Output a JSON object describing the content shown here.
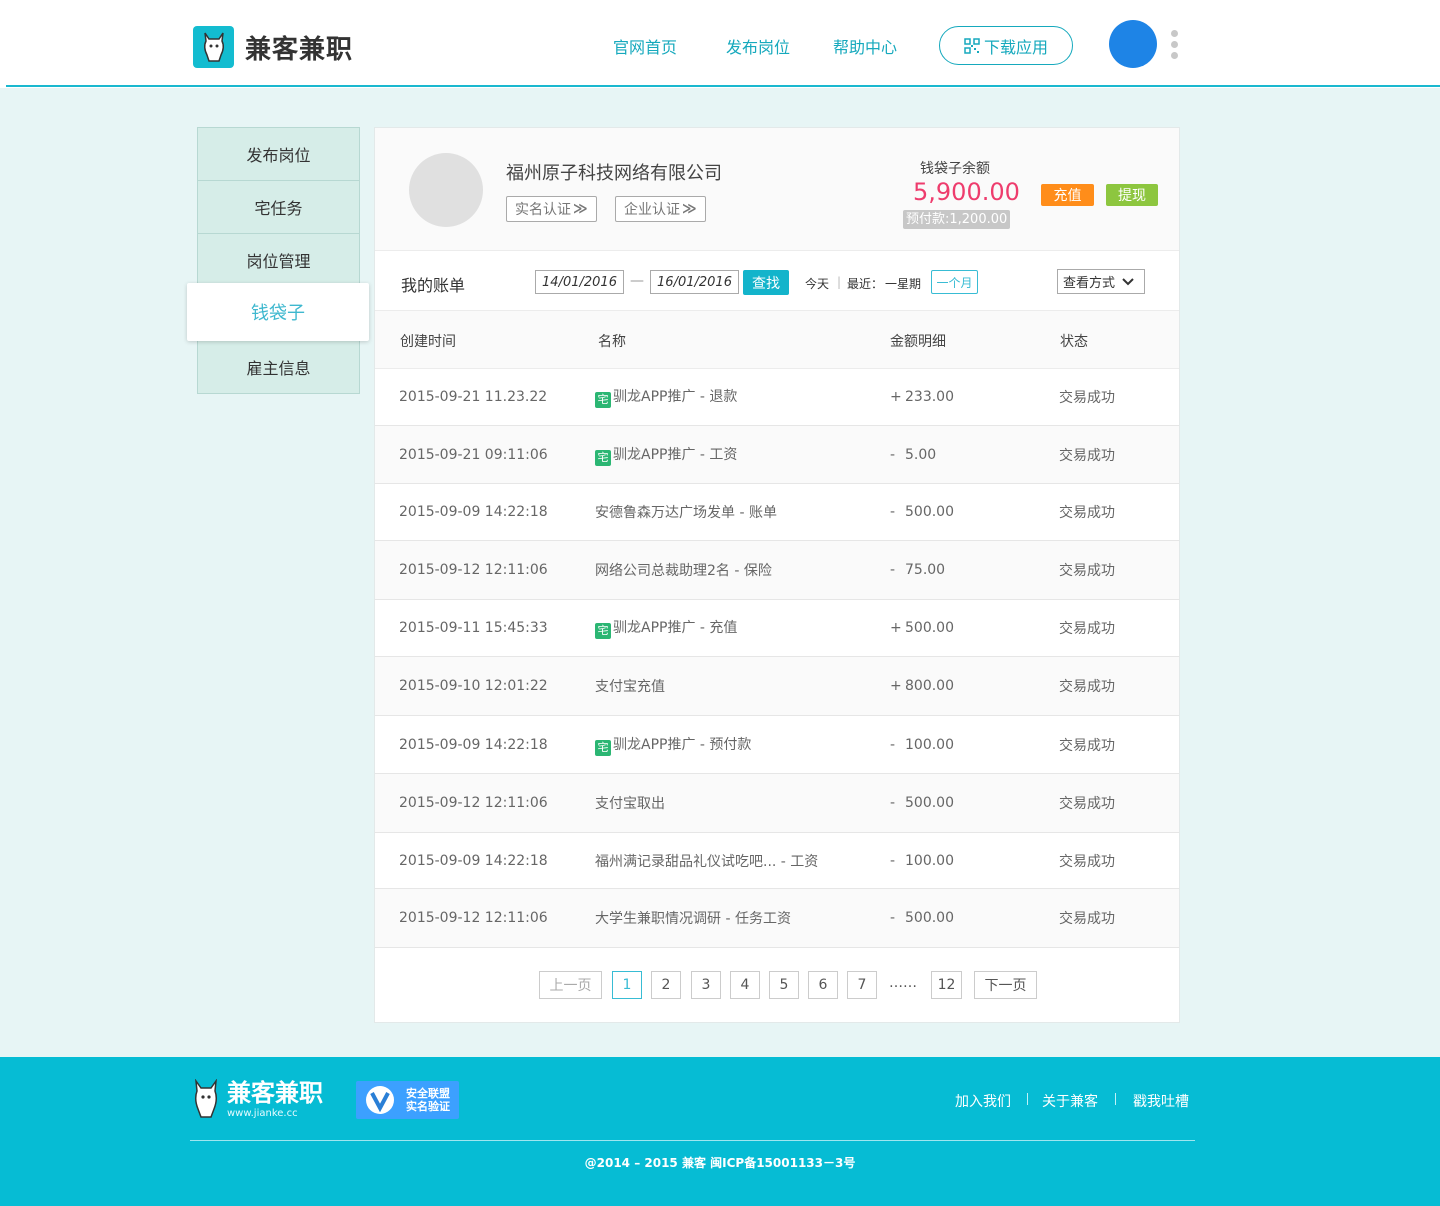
{
  "header": {
    "logo_text": "兼客兼职",
    "nav": [
      "官网首页",
      "发布岗位",
      "帮助中心"
    ],
    "download_label": "下载应用"
  },
  "sidebar": {
    "items": [
      "发布岗位",
      "宅任务",
      "岗位管理",
      "钱袋子",
      "雇主信息"
    ],
    "active": "钱袋子"
  },
  "profile": {
    "company_name": "福州原子科技网络有限公司",
    "cert_realname": "实名认证",
    "cert_company": "企业认证",
    "balance_label": "钱袋子余额",
    "balance_value": "5,900.00",
    "prepay": "预付款:1,200.00",
    "recharge_label": "充值",
    "withdraw_label": "提现"
  },
  "bill": {
    "title": "我的账单",
    "date_from": "14/01/2016",
    "date_sep": "—",
    "date_to": "16/01/2016",
    "search_label": "查找",
    "today": "今天",
    "recent": "最近：",
    "week": "一星期",
    "month": "一个月",
    "view_mode": "查看方式"
  },
  "table": {
    "headers": [
      "创建时间",
      "名称",
      "金额明细",
      "状态"
    ],
    "tag_label": "宅",
    "rows": [
      {
        "time": "2015-09-21 11.23.22",
        "tagged": true,
        "name": "驯龙APP推广 - 退款",
        "sign": "+",
        "amount": "233.00",
        "status": "交易成功"
      },
      {
        "time": "2015-09-21 09:11:06",
        "tagged": true,
        "name": "驯龙APP推广 - 工资",
        "sign": "-",
        "amount": "5.00",
        "status": "交易成功"
      },
      {
        "time": "2015-09-09 14:22:18",
        "tagged": false,
        "name": "安德鲁森万达广场发单 - 账单",
        "sign": "-",
        "amount": "500.00",
        "status": "交易成功"
      },
      {
        "time": "2015-09-12 12:11:06",
        "tagged": false,
        "name": "网络公司总裁助理2名 - 保险",
        "sign": "-",
        "amount": "75.00",
        "status": "交易成功"
      },
      {
        "time": "2015-09-11 15:45:33",
        "tagged": true,
        "name": "驯龙APP推广 - 充值",
        "sign": "+",
        "amount": "500.00",
        "status": "交易成功"
      },
      {
        "time": "2015-09-10 12:01:22",
        "tagged": false,
        "name": "支付宝充值",
        "sign": "+",
        "amount": "800.00",
        "status": "交易成功"
      },
      {
        "time": "2015-09-09 14:22:18",
        "tagged": true,
        "name": "驯龙APP推广 - 预付款",
        "sign": "-",
        "amount": "100.00",
        "status": "交易成功"
      },
      {
        "time": "2015-09-12 12:11:06",
        "tagged": false,
        "name": "支付宝取出",
        "sign": "-",
        "amount": "500.00",
        "status": "交易成功"
      },
      {
        "time": "2015-09-09 14:22:18",
        "tagged": false,
        "name": "福州满记录甜品礼仪试吃吧... - 工资",
        "sign": "-",
        "amount": "100.00",
        "status": "交易成功"
      },
      {
        "time": "2015-09-12 12:11:06",
        "tagged": false,
        "name": "大学生兼职情况调研 - 任务工资",
        "sign": "-",
        "amount": "500.00",
        "status": "交易成功"
      }
    ]
  },
  "pagination": {
    "prev": "上一页",
    "pages": [
      "1",
      "2",
      "3",
      "4",
      "5",
      "6",
      "7"
    ],
    "current": "1",
    "ellipsis": "……",
    "last": "12",
    "next": "下一页"
  },
  "footer": {
    "logo_text": "兼客兼职",
    "logo_url": "www.jianke.cc",
    "badge_line1": "安全联盟",
    "badge_line2": "实名验证",
    "links": [
      "加入我们",
      "关于兼客",
      "戳我吐槽"
    ],
    "copyright": "@2014 – 2015  兼客  闽ICP备15001133－3号"
  },
  "colors": {
    "accent": "#13b4cb",
    "balance": "#ee3c6d",
    "recharge": "#ff8d1a",
    "withdraw": "#8dc63f",
    "tag": "#2bb673",
    "footer": "#06bcd4"
  }
}
